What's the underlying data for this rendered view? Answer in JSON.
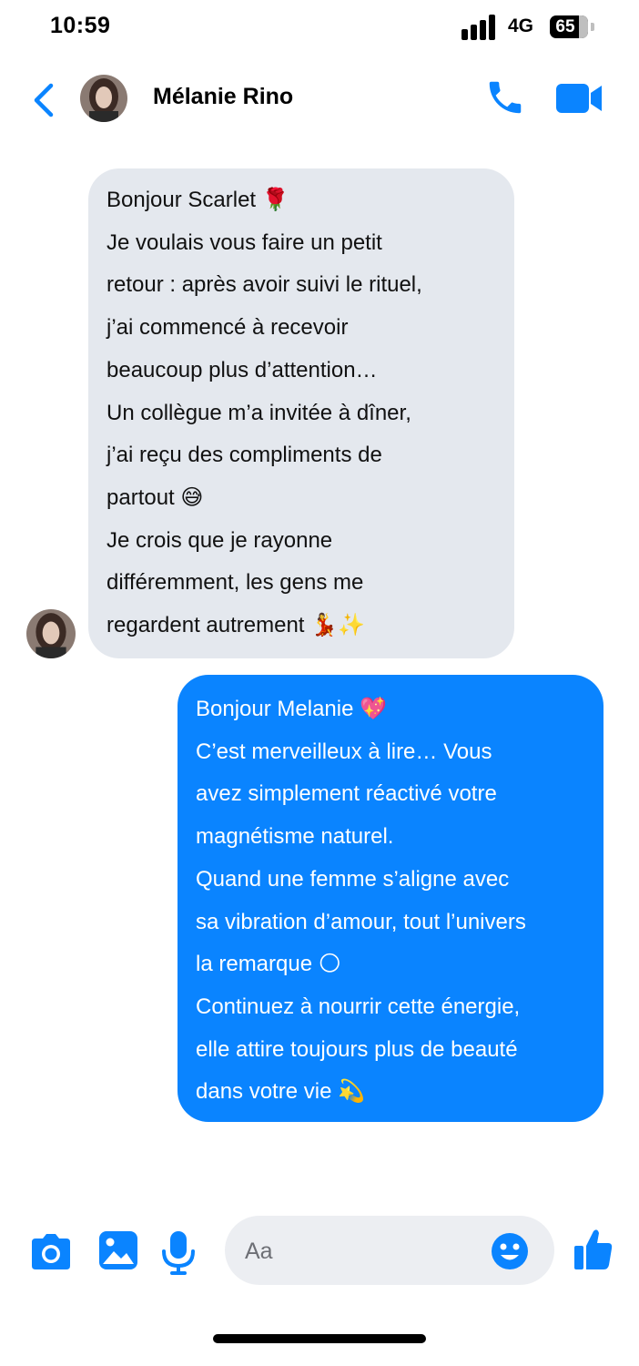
{
  "status_bar": {
    "time": "10:59",
    "network": "4G",
    "battery": "65"
  },
  "header": {
    "contact_name": "Mélanie Rino"
  },
  "messages": [
    {
      "direction": "incoming",
      "lines": [
        "Bonjour Scarlet 🌹",
        "Je voulais vous faire un petit",
        "retour : après avoir suivi le rituel,",
        "j’ai commencé à recevoir",
        "beaucoup plus d’attention…",
        "Un collègue m’a invitée à dîner,",
        "j’ai reçu des compliments de",
        "partout 😅",
        "Je crois que je rayonne",
        "différemment, les gens me",
        "regardent autrement 💃✨"
      ]
    },
    {
      "direction": "outgoing",
      "lines": [
        "Bonjour Melanie 💖",
        "C’est merveilleux à lire… Vous",
        "avez simplement réactivé votre",
        "magnétisme naturel.",
        "Quand une femme s’aligne avec",
        "sa vibration d’amour, tout l’univers",
        "la remarque 🌕",
        "Continuez à nourrir cette énergie,",
        "elle attire toujours plus de beauté",
        "dans votre vie 💫"
      ]
    }
  ],
  "composer": {
    "placeholder": "Aa"
  },
  "colors": {
    "accent": "#0a84ff",
    "incoming_bubble": "#e4e8ee",
    "outgoing_bubble": "#0a84ff"
  },
  "icons": [
    "back-chevron-icon",
    "phone-icon",
    "video-camera-icon",
    "camera-icon",
    "gallery-icon",
    "microphone-icon",
    "emoji-icon",
    "thumbs-up-icon"
  ]
}
